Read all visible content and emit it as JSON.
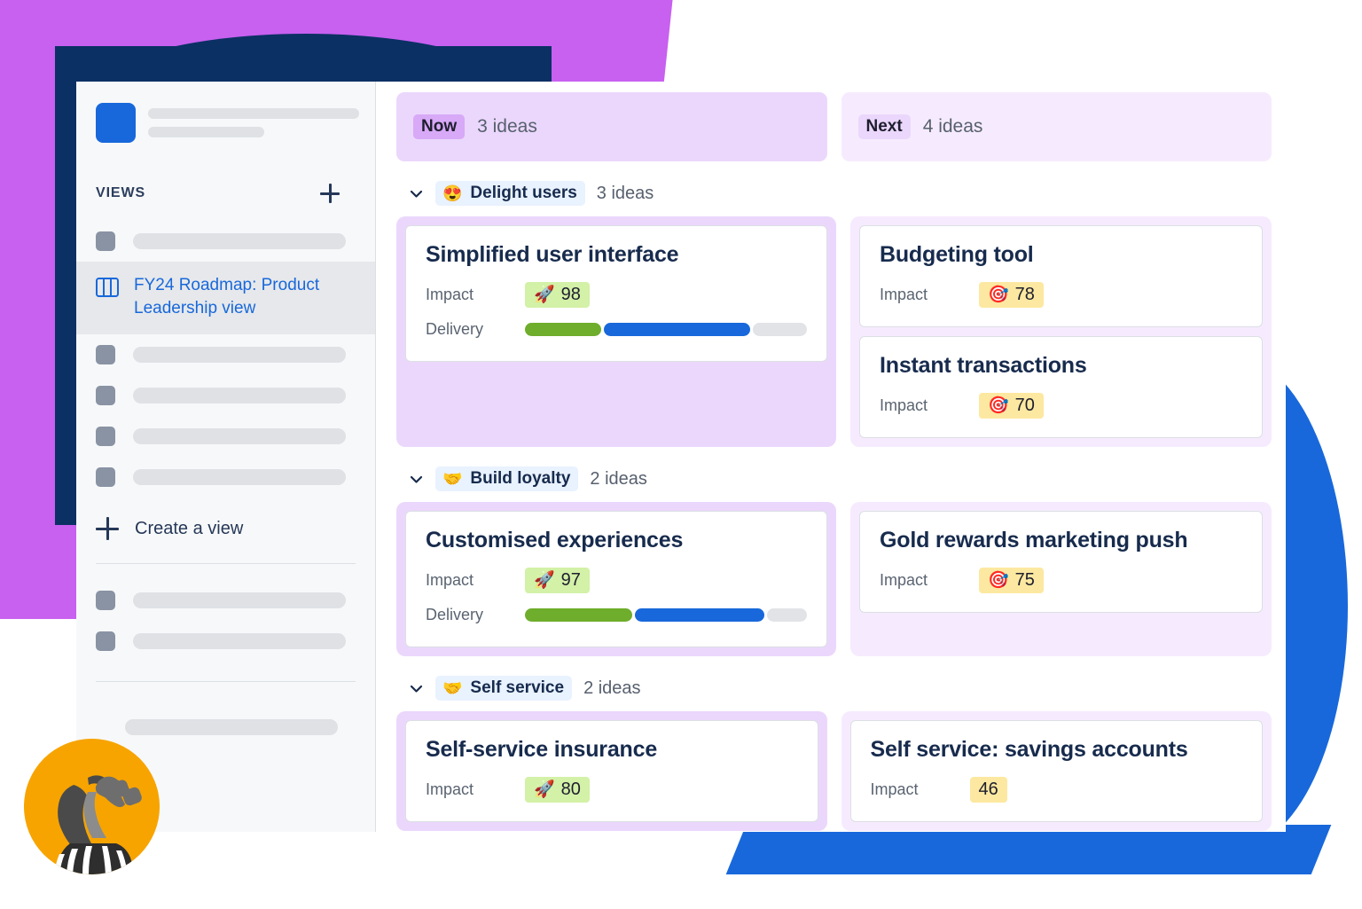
{
  "sidebar": {
    "views_section_title": "VIEWS",
    "add_view_icon": "plus-icon",
    "active_view": {
      "label": "FY24 Roadmap: Product Leadership view",
      "icon": "board-icon"
    },
    "create_view": {
      "label": "Create a view",
      "icon": "plus-icon"
    },
    "placeholder_items_above": 1,
    "placeholder_items_below": 4,
    "placeholder_items_footer": 2,
    "placeholder_items_after_divider": 1
  },
  "board": {
    "columns": [
      {
        "id": "now",
        "chip": "Now",
        "count_label": "3 ideas"
      },
      {
        "id": "next",
        "chip": "Next",
        "count_label": "4 ideas"
      }
    ],
    "groups": [
      {
        "emoji": "😍",
        "emoji_name": "smiling-face-with-hearts-icon",
        "label": "Delight users",
        "count_label": "3 ideas",
        "now_cards": [
          {
            "title": "Simplified user interface",
            "impact_label": "Impact",
            "impact_value": "98",
            "impact_emoji": "🚀",
            "impact_emoji_name": "rocket-icon",
            "impact_tone": "green",
            "delivery_label": "Delivery",
            "delivery_segments": [
              {
                "tone": "green",
                "percent": 27
              },
              {
                "tone": "blue",
                "percent": 52
              },
              {
                "tone": "grey",
                "percent": 21
              }
            ]
          }
        ],
        "next_cards": [
          {
            "title": "Budgeting tool",
            "impact_label": "Impact",
            "impact_value": "78",
            "impact_emoji": "🎯",
            "impact_emoji_name": "direct-hit-icon",
            "impact_tone": "yellow"
          },
          {
            "title": "Instant transactions",
            "impact_label": "Impact",
            "impact_value": "70",
            "impact_emoji": "🎯",
            "impact_emoji_name": "direct-hit-icon",
            "impact_tone": "yellow"
          }
        ]
      },
      {
        "emoji": "🤝",
        "emoji_name": "handshake-icon",
        "label": "Build loyalty",
        "count_label": "2 ideas",
        "now_cards": [
          {
            "title": "Customised experiences",
            "impact_label": "Impact",
            "impact_value": "97",
            "impact_emoji": "🚀",
            "impact_emoji_name": "rocket-icon",
            "impact_tone": "green",
            "delivery_label": "Delivery",
            "delivery_segments": [
              {
                "tone": "green",
                "percent": 38
              },
              {
                "tone": "blue",
                "percent": 46
              },
              {
                "tone": "grey",
                "percent": 16
              }
            ]
          }
        ],
        "next_cards": [
          {
            "title": "Gold rewards marketing push",
            "impact_label": "Impact",
            "impact_value": "75",
            "impact_emoji": "🎯",
            "impact_emoji_name": "direct-hit-icon",
            "impact_tone": "yellow"
          }
        ]
      },
      {
        "emoji": "🤝",
        "emoji_name": "handshake-icon",
        "label": "Self service",
        "count_label": "2 ideas",
        "now_cards": [
          {
            "title": "Self-service insurance",
            "impact_label": "Impact",
            "impact_value": "80",
            "impact_emoji": "🚀",
            "impact_emoji_name": "rocket-icon",
            "impact_tone": "green"
          }
        ],
        "next_cards": [
          {
            "title": "Self service: savings accounts",
            "impact_label": "Impact",
            "impact_value": "46",
            "impact_emoji": "",
            "impact_emoji_name": "none",
            "impact_tone": "yellow"
          }
        ]
      }
    ]
  },
  "colors": {
    "accent_blue": "#1868DB",
    "now_column": "#EBD7FC",
    "next_column": "#F6EBFE",
    "now_chip": "#D8A9F7",
    "next_chip": "#EBD7FC",
    "group_chip": "#E9F2FF",
    "impact_green": "#D3F1A7",
    "impact_yellow": "#FCE8A0",
    "delivery_green": "#6FAD2C",
    "delivery_blue": "#1868DB",
    "delivery_grey": "#E1E3E6",
    "backdrop_purple": "#C860F0",
    "backdrop_navy": "#0B3064",
    "backdrop_blue": "#1868DB",
    "avatar_orange": "#F7A400"
  }
}
